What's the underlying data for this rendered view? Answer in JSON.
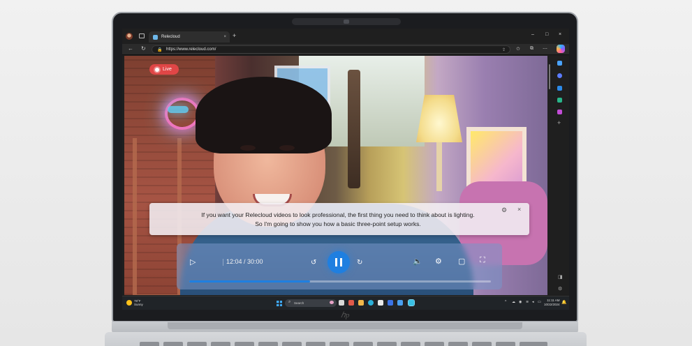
{
  "browser": {
    "tab_title": "Relecloud",
    "tab_close": "×",
    "new_tab": "+",
    "url": "https://www.relecloud.com/",
    "window_controls": [
      "–",
      "□",
      "×"
    ],
    "nav": {
      "back": "←",
      "refresh": "↻"
    }
  },
  "video": {
    "live_label": "Live",
    "caption": "If you want your Relecloud videos to look professional, the first thing you need to think about is lighting. So I'm going to show you how a basic three-point setup works.",
    "time_display": "12:04 / 30:00",
    "progress": 0.4
  },
  "controls": {
    "play": "▷",
    "rewind": "↺",
    "forward": "↻",
    "volume": "🔈",
    "settings": "⚙",
    "miniplayer": "▢",
    "fullscreen": "⛶"
  },
  "caption_controls": {
    "settings": "⚙",
    "close": "×"
  },
  "taskbar": {
    "weather_temp": "78°F",
    "weather_desc": "Sunny",
    "search_placeholder": "Search",
    "clock_time": "11:11 AM",
    "clock_date": "10/22/2024"
  },
  "colors": {
    "accent": "#1f7fe0",
    "live": "#e04646"
  }
}
